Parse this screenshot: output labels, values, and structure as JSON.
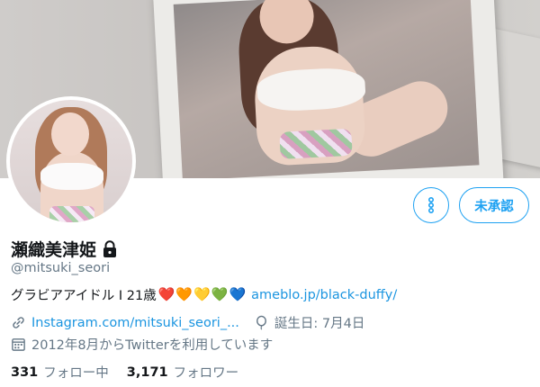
{
  "profile": {
    "display_name": "瀬織美津姫",
    "handle": "@mitsuki_seori",
    "bio_text": "グラビアアイドル I 21歳",
    "bio_hearts": [
      "❤️",
      "🧡",
      "💛",
      "💚",
      "💙"
    ],
    "bio_link": "ameblo.jp/black-duffy/",
    "website": "Instagram.com/mitsuki_seori_...",
    "birthday": "誕生日: 7月4日",
    "joined": "2012年8月からTwitterを利用しています",
    "following_count": "331",
    "following_label": "フォロー中",
    "followers_count": "3,171",
    "followers_label": "フォロワー"
  },
  "buttons": {
    "follow_request_label": "未承認"
  },
  "icons": {
    "lock": "lock-icon",
    "more": "more-vertical-icon",
    "link": "link-icon",
    "birthday": "balloon-icon",
    "joined": "calendar-icon"
  },
  "colors": {
    "accent": "#1da1f2",
    "link": "#1b95e0",
    "secondary_text": "#657786",
    "primary_text": "#14171a"
  }
}
